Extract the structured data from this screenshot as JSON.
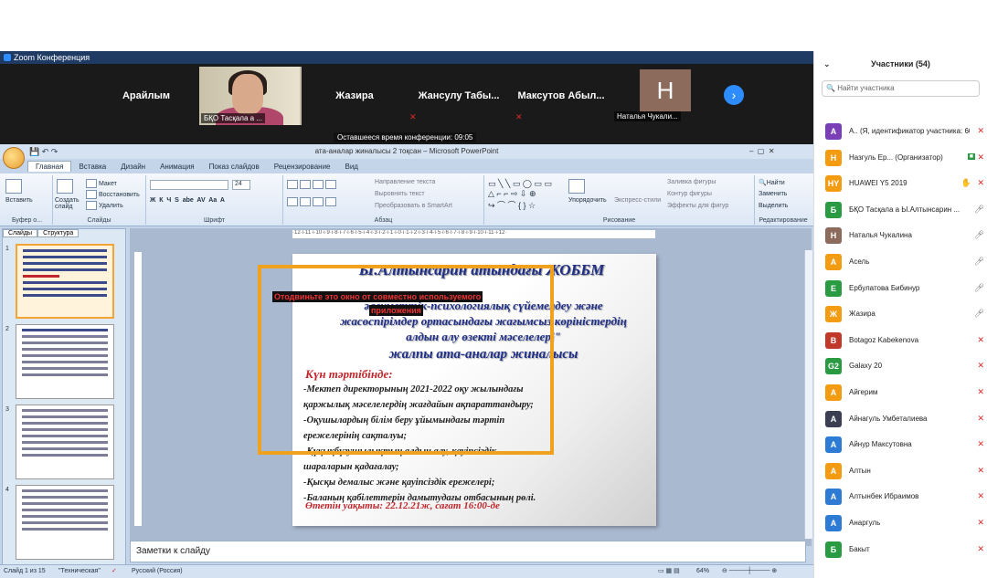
{
  "zoom": {
    "window_title": "Zoom Конференция",
    "tip": "Оставшееся время конференции: 09:05"
  },
  "tiles": [
    {
      "name": "Арайлым"
    },
    {
      "name": "БҚО Тасқала а ..."
    },
    {
      "name": "Жазира"
    },
    {
      "name": "Жансулу Табы..."
    },
    {
      "name": "Максутов  Абыл..."
    },
    {
      "name": "Наталья Чукали..."
    }
  ],
  "tile_h_letter": "H",
  "ppt": {
    "title": "ата-аналар жиналысы 2 тоқсан – Microsoft PowerPoint",
    "tabs": [
      "Главная",
      "Вставка",
      "Дизайн",
      "Анимация",
      "Показ слайдов",
      "Рецензирование",
      "Вид"
    ],
    "groups": [
      "Буфер о...",
      "Слайды",
      "Шрифт",
      "Абзац",
      "Рисование",
      "Редактирование"
    ],
    "buttons": {
      "paste": "Вставить",
      "new_slide": "Создать слайд",
      "layout": "Макет",
      "reset": "Восстановить",
      "delete": "Удалить",
      "text_dir": "Направление текста",
      "align_text": "Выровнять текст",
      "smartart": "Преобразовать в SmartArt",
      "arrange": "Упорядочить",
      "quick_styles": "Экспресс-стили",
      "fill": "Заливка фигуры",
      "outline": "Контур фигуры",
      "effects": "Эффекты для фигур",
      "find": "Найти",
      "replace": "Заменить",
      "select": "Выделить",
      "font_size": "24"
    },
    "pane_tabs": [
      "Слайды",
      "Структура"
    ],
    "thumb_numbers": [
      "1",
      "2",
      "3",
      "4"
    ],
    "notes": "Заметки к слайду",
    "status": {
      "slide": "Слайд 1 из 15",
      "theme": "\"Техническая\"",
      "lang": "Русский (Россия)",
      "zoom": "64%"
    }
  },
  "slide": {
    "title": "Ы.Алтынсарин атындағы ЖОББМ",
    "sub_lines": [
      "әлеуметтік-психологиялық сүйемелдеу және",
      "жасөспірімдер ортасындағы жағымсыз көріністердің",
      "алдын алу өзекті мәселелері\""
    ],
    "sub2": "жалпы ата-аналар жиналысы",
    "agenda": "Күн тәртібінде:",
    "items": [
      "-Мектеп директорының 2021-2022 оқу жылындағы",
      "қаржылық мәселелердің жағдайын ақпараттандыру;",
      "-Оқушылардың білім беру ұйымындағы тәртіп",
      "ережелерінің сақталуы;",
      "-Құқықбұзушылықтың алдын алу, қауіпсіздік",
      "шараларын қадағалау;",
      "-Қысқы демалыс және қауіпсіздік ережелері;",
      "-Баланың қабілеттерін дамытудағы отбасының рөлі."
    ],
    "footer": "Өтетін уақыты: 22.12.21ж, сағат 16:00-де"
  },
  "warning": {
    "line1": "Отодвиньте это окно от совместно используемого",
    "line2": "приложения"
  },
  "panel": {
    "title": "Участники (54)",
    "search_placeholder": "Найти участника",
    "participants": [
      {
        "avatar": "A",
        "color": "#7a3fb7",
        "name": "A.. (Я, идентификатор участника: 604..."
      },
      {
        "avatar": "Н",
        "color": "#f39c12",
        "name": "Назгуль Ер... (Организатор)"
      },
      {
        "avatar": "HY",
        "color": "#f39c12",
        "name": "HUAWEI Y5 2019"
      },
      {
        "avatar": "Б",
        "color": "#2a9b43",
        "name": "БҚО Тасқала а Ы.Алтынсарин ..."
      },
      {
        "avatar": "Н",
        "color": "#8c6a5c",
        "name": "Наталья Чукалина"
      },
      {
        "avatar": "А",
        "color": "#f39c12",
        "name": "Асель"
      },
      {
        "avatar": "Е",
        "color": "#2a9b43",
        "name": "Ербулатова Бибинур"
      },
      {
        "avatar": "Ж",
        "color": "#f39c12",
        "name": "Жазира"
      },
      {
        "avatar": "B",
        "color": "#c0392b",
        "name": "Botagoz Kabekenova"
      },
      {
        "avatar": "G2",
        "color": "#2a9b43",
        "name": "Galaxy 20"
      },
      {
        "avatar": "А",
        "color": "#f39c12",
        "name": "Айгерим"
      },
      {
        "avatar": "А",
        "color": "#3b3f51",
        "name": "Айнагуль Умбеталиева"
      },
      {
        "avatar": "А",
        "color": "#2e7bd6",
        "name": "Айнур Максутовна"
      },
      {
        "avatar": "А",
        "color": "#f39c12",
        "name": "Алтын"
      },
      {
        "avatar": "А",
        "color": "#2e7bd6",
        "name": "Алтынбек Ибраимов"
      },
      {
        "avatar": "А",
        "color": "#2e7bd6",
        "name": "Анаргуль"
      },
      {
        "avatar": "Б",
        "color": "#2a9b43",
        "name": "Бакыт"
      }
    ]
  }
}
